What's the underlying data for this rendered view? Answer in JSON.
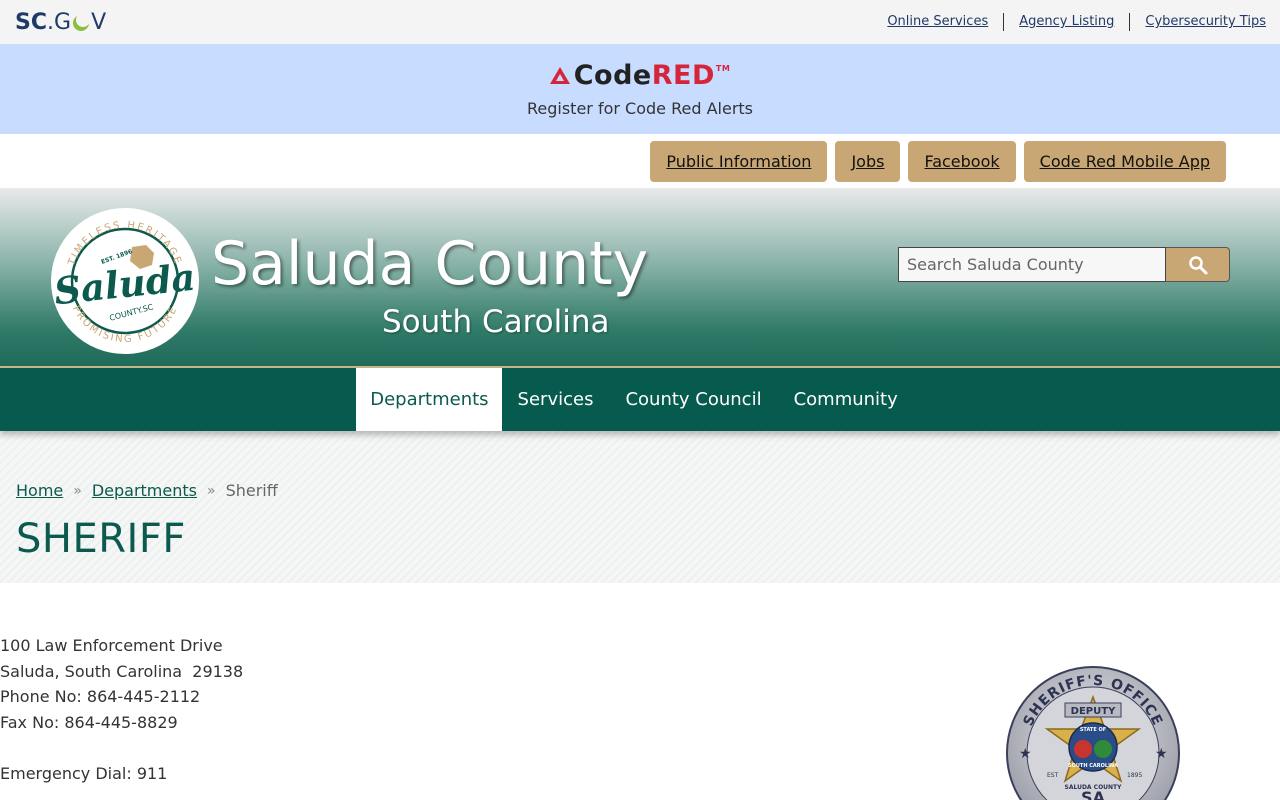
{
  "scgov": {
    "logo_sc": "SC",
    "logo_dot": ".",
    "logo_g": "G",
    "logo_v": "V",
    "links": [
      "Online Services",
      "Agency Listing",
      "Cybersecurity Tips"
    ]
  },
  "codered": {
    "logo_code": "Code",
    "logo_red": "RED",
    "logo_tm": "TM",
    "tagline": "Register for Code Red Alerts"
  },
  "quick_links": [
    "Public Information",
    "Jobs",
    "Facebook",
    "Code Red Mobile App"
  ],
  "header": {
    "title": "Saluda County",
    "subtitle": "South Carolina",
    "search_placeholder": "Search Saluda County",
    "seal": {
      "top_text": "TIMELESS HERITAGE",
      "bottom_text": "PROMISING FUTURE",
      "est": "EST. 1896",
      "name": "Saluda",
      "county": "COUNTY.SC"
    }
  },
  "nav": {
    "items": [
      "Departments",
      "Services",
      "County Council",
      "Community"
    ],
    "active": "Departments"
  },
  "breadcrumb": {
    "home": "Home",
    "departments": "Departments",
    "separator": "»",
    "current": "Sheriff"
  },
  "page_title": "SHERIFF",
  "contact": {
    "address1": "100 Law Enforcement Drive",
    "address2": "Saluda, South Carolina  29138",
    "phone": "Phone No: 864-445-2112",
    "fax": "Fax No: 864-445-8829",
    "emergency": "Emergency Dial: 911"
  },
  "badge": {
    "top_text": "SHERIFF'S OFFICE",
    "ribbon": "DEPUTY",
    "state_text": "STATE OF",
    "sc_text": "SOUTH CAROLINA",
    "est": "EST",
    "year": "1895",
    "county_text": "SALUDA COUNTY",
    "bottom_text": "SA"
  },
  "colors": {
    "brand_green": "#065a4e",
    "gold": "#c9a775",
    "codered_red": "#d6243a",
    "codered_band": "#c8dcff"
  }
}
